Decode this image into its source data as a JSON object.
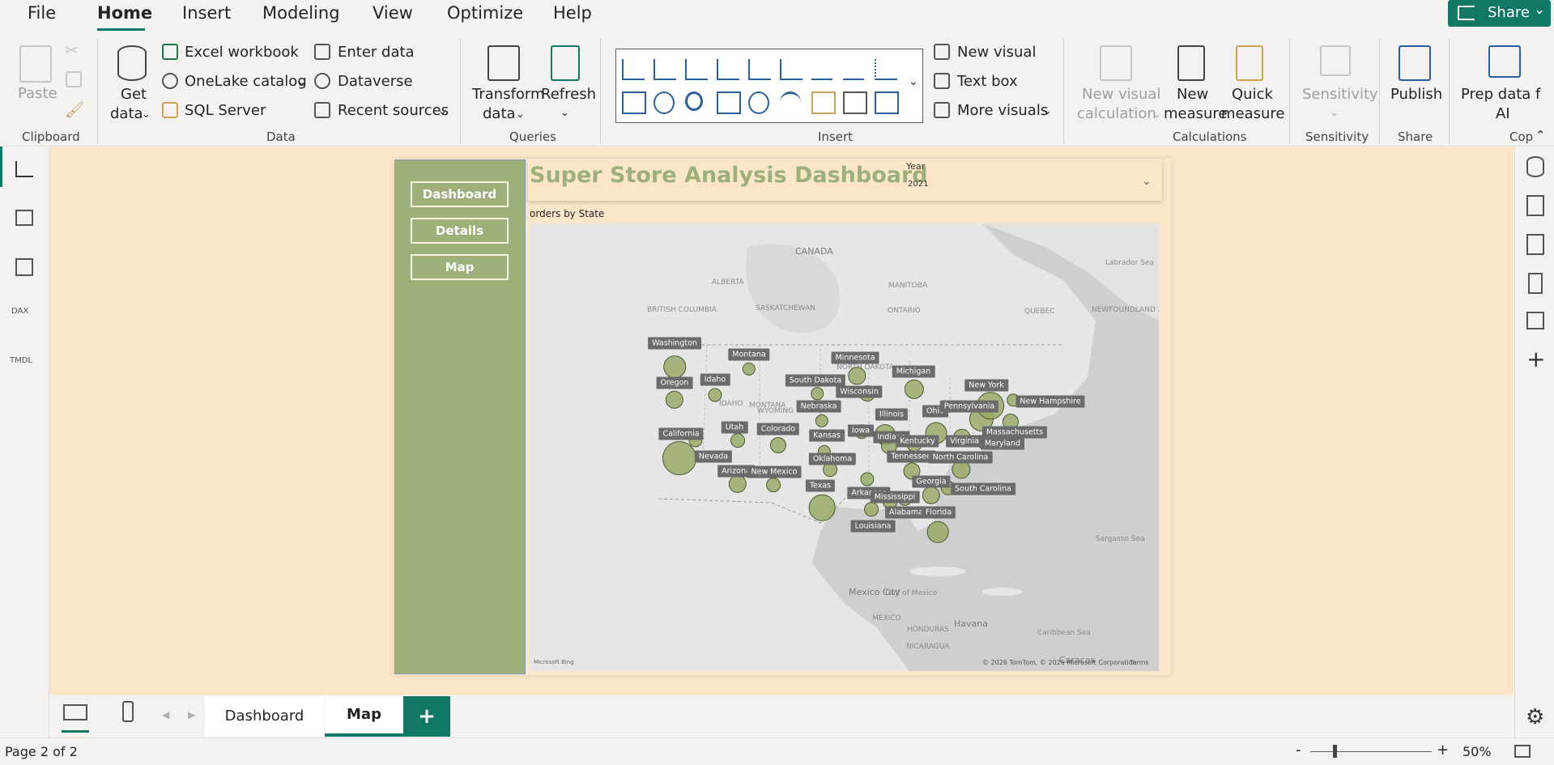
{
  "menu": {
    "items": [
      "File",
      "Home",
      "Insert",
      "Modeling",
      "View",
      "Optimize",
      "Help"
    ],
    "active": "Home",
    "share_label": "Share"
  },
  "ribbon": {
    "clipboard": {
      "paste": "Paste",
      "group": "Clipboard"
    },
    "data": {
      "get_data_1": "Get",
      "get_data_2": "data",
      "excel": "Excel workbook",
      "onelake": "OneLake catalog",
      "sql": "SQL Server",
      "enter_data": "Enter data",
      "dataverse": "Dataverse",
      "recent": "Recent sources",
      "group": "Data"
    },
    "queries": {
      "transform_1": "Transform",
      "transform_2": "data",
      "refresh": "Refresh",
      "group": "Queries"
    },
    "insert": {
      "new_visual": "New visual",
      "text_box": "Text box",
      "more_visuals": "More visuals",
      "group": "Insert"
    },
    "calculations": {
      "nvc_1": "New visual",
      "nvc_2": "calculation",
      "new_measure_1": "New",
      "new_measure_2": "measure",
      "quick_measure_1": "Quick",
      "quick_measure_2": "measure",
      "group": "Calculations"
    },
    "sensitivity": {
      "label": "Sensitivity",
      "group": "Sensitivity"
    },
    "share": {
      "publish": "Publish",
      "group": "Share"
    },
    "copilot": {
      "prep_1": "Prep data f",
      "prep_2": "AI",
      "group": "Cop"
    }
  },
  "report": {
    "nav_buttons": [
      "Dashboard",
      "Details",
      "Map"
    ],
    "title": "Super Store Analysis Dashboard",
    "slicer": {
      "label": "Year",
      "value": "2021"
    },
    "map_title": "orders by State",
    "map_attribution": "© 2026 TomTom, © 2026 Microsoft Corporation",
    "map_terms": "Terms",
    "map_logo": "Microsoft Bing"
  },
  "map_geo_labels": [
    {
      "text": "CANADA",
      "cls": "big"
    },
    {
      "text": "ALBERTA"
    },
    {
      "text": "BRITISH COLUMBIA"
    },
    {
      "text": "SASKATCHEWAN"
    },
    {
      "text": "MANITOBA"
    },
    {
      "text": "ONTARIO"
    },
    {
      "text": "QUEBEC"
    },
    {
      "text": "NEWFOUNDLAND AND LABRADOR"
    },
    {
      "text": "Labrador Sea"
    },
    {
      "text": "MONTANA"
    },
    {
      "text": "IDAHO"
    },
    {
      "text": "WYOMING"
    },
    {
      "text": "NORTH DAKOTA"
    },
    {
      "text": "Gulf of Mexico"
    },
    {
      "text": "Mexico City",
      "cls": "big"
    },
    {
      "text": "MEXICO"
    },
    {
      "text": "Havana",
      "cls": "big"
    },
    {
      "text": "Sargasso Sea"
    },
    {
      "text": "Caribbean Sea"
    },
    {
      "text": "Caracas",
      "cls": "big"
    },
    {
      "text": "HONDURAS"
    },
    {
      "text": "NICARAGUA"
    }
  ],
  "states": [
    {
      "name": "Washington",
      "value": 3
    },
    {
      "name": "Oregon",
      "value": 1.5
    },
    {
      "name": "California",
      "value": 10
    },
    {
      "name": "Nevada",
      "value": 0.5
    },
    {
      "name": "Idaho",
      "value": 0.5
    },
    {
      "name": "Montana",
      "value": 0.4
    },
    {
      "name": "Utah",
      "value": 0.6
    },
    {
      "name": "Arizona",
      "value": 1.5
    },
    {
      "name": "Colorado",
      "value": 1
    },
    {
      "name": "New Mexico",
      "value": 0.6
    },
    {
      "name": "Texas",
      "value": 5
    },
    {
      "name": "Oklahoma",
      "value": 0.6
    },
    {
      "name": "Kansas",
      "value": 0.4
    },
    {
      "name": "Nebraska",
      "value": 0.4
    },
    {
      "name": "South Dakota",
      "value": 0.3
    },
    {
      "name": "Minnesota",
      "value": 1.3
    },
    {
      "name": "Wisconsin",
      "value": 1
    },
    {
      "name": "Iowa",
      "value": 0.6
    },
    {
      "name": "Illinois",
      "value": 2.5
    },
    {
      "name": "Michigan",
      "value": 2
    },
    {
      "name": "Indiana",
      "value": 1
    },
    {
      "name": "Kentucky",
      "value": 1
    },
    {
      "name": "Tennessee",
      "value": 1.2
    },
    {
      "name": "Ohio",
      "value": 2.8
    },
    {
      "name": "Arkansas",
      "value": 0.5
    },
    {
      "name": "Louisiana",
      "value": 0.6
    },
    {
      "name": "Mississippi",
      "value": 0.6
    },
    {
      "name": "Alabama",
      "value": 0.7
    },
    {
      "name": "Georgia",
      "value": 1.5
    },
    {
      "name": "Florida",
      "value": 2.7
    },
    {
      "name": "South Carolina",
      "value": 0.7
    },
    {
      "name": "North Carolina",
      "value": 1.7
    },
    {
      "name": "Virginia",
      "value": 1.5
    },
    {
      "name": "Maryland",
      "value": 0.8
    },
    {
      "name": "Pennsylvania",
      "value": 4
    },
    {
      "name": "New York",
      "value": 5.5
    },
    {
      "name": "Massachusetts",
      "value": 1
    },
    {
      "name": "New Hampshire",
      "value": 0.3
    }
  ],
  "pages": {
    "tabs": [
      "Dashboard",
      "Map"
    ],
    "active": "Map",
    "add_label": "+",
    "status": "Page 2 of 2"
  },
  "zoom": {
    "value": "50%",
    "minus": "-",
    "plus": "+"
  },
  "colors": {
    "accent": "#117865",
    "nav": "#9db07a",
    "canvas": "#fbe6c9",
    "bubble": "#98aa68"
  }
}
